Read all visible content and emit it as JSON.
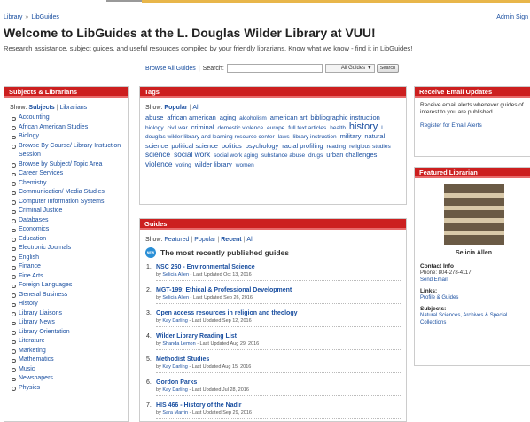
{
  "breadcrumb": {
    "library": "Library",
    "separator": "»",
    "libguides": "LibGuides"
  },
  "admin_label": "Admin Sign",
  "page_title": "Welcome to LibGuides at the L. Douglas Wilder Library at VUU!",
  "subtitle": "Research assistance, subject guides, and useful resources compiled by your friendly librarians. Know what we know - find it in LibGuides!",
  "search": {
    "browse_label": "Browse All Guides",
    "separator": "|",
    "search_label": "Search:",
    "input_value": "",
    "scope_selected": "All Guides ▼",
    "button_label": "Search"
  },
  "subjects": {
    "header": "Subjects & Librarians",
    "show_label": "Show:",
    "subjects_tab": "Subjects",
    "pipe": "|",
    "librarians_tab": "Librarians",
    "items": [
      "Accounting",
      "African American Studies",
      "Biology",
      "Browse By Course/ Library Instuction Session",
      "Browse by Subject/ Topic Area",
      "Career Services",
      "Chemistry",
      "Communication/ Media Studies",
      "Computer Information Systems",
      "Criminal Justice",
      "Databases",
      "Economics",
      "Education",
      "Electronic Journals",
      "English",
      "Finance",
      "Fine Arts",
      "Foreign Languages",
      "General Business",
      "History",
      "Library Liaisons",
      "Library News",
      "Library Orientation",
      "Literature",
      "Marketing",
      "Mathematics",
      "Music",
      "Newspapers",
      "Physics"
    ]
  },
  "tags": {
    "header": "Tags",
    "show_label": "Show:",
    "popular_tab": "Popular",
    "pipe": "|",
    "all_tab": "All",
    "cloud": [
      {
        "text": "abuse",
        "size": 2
      },
      {
        "text": "african american",
        "size": 2
      },
      {
        "text": "aging",
        "size": 2
      },
      {
        "text": "alcoholism",
        "size": 1
      },
      {
        "text": "american art",
        "size": 2
      },
      {
        "text": "bibliographic instruction",
        "size": 2
      },
      {
        "text": "biology",
        "size": 1
      },
      {
        "text": "civil war",
        "size": 1
      },
      {
        "text": "criminal",
        "size": 2
      },
      {
        "text": "domestic violence",
        "size": 1
      },
      {
        "text": "europe",
        "size": 1
      },
      {
        "text": "full text articles",
        "size": 1
      },
      {
        "text": "health",
        "size": 1
      },
      {
        "text": "history",
        "size": 4
      },
      {
        "text": "l. douglas wilder library and learning resource center",
        "size": 1
      },
      {
        "text": "laws",
        "size": 1
      },
      {
        "text": "library instruction",
        "size": 1
      },
      {
        "text": "military",
        "size": 2
      },
      {
        "text": "natural science",
        "size": 2
      },
      {
        "text": "political science",
        "size": 2
      },
      {
        "text": "politics",
        "size": 2
      },
      {
        "text": "psychology",
        "size": 2
      },
      {
        "text": "racial profiling",
        "size": 2
      },
      {
        "text": "reading",
        "size": 1
      },
      {
        "text": "religious studies",
        "size": 1
      },
      {
        "text": "science",
        "size": 3
      },
      {
        "text": "social work",
        "size": 3
      },
      {
        "text": "social work aging",
        "size": 1
      },
      {
        "text": "substance abuse",
        "size": 1
      },
      {
        "text": "drugs",
        "size": 1
      },
      {
        "text": "urban challenges",
        "size": 2
      },
      {
        "text": "violence",
        "size": 3
      },
      {
        "text": "voting",
        "size": 1
      },
      {
        "text": "wilder library",
        "size": 2
      },
      {
        "text": "women",
        "size": 1
      }
    ]
  },
  "guides": {
    "header": "Guides",
    "show_label": "Show:",
    "featured_tab": "Featured",
    "pipe": "|",
    "popular_tab": "Popular",
    "recent_tab": "Recent",
    "all_tab": "All",
    "new_badge": "NEW",
    "recent_heading": "The most recently published guides",
    "by_label": "by",
    "updated_label": "- Last Updated",
    "items": [
      {
        "num": "1.",
        "title": "NSC 260 - Environmental Science",
        "author": "Selicia Allen",
        "date": "Oct 13, 2016"
      },
      {
        "num": "2.",
        "title": "MGT-199: Ethical & Professional Development",
        "author": "Selicia Allen",
        "date": "Sep 26, 2016"
      },
      {
        "num": "3.",
        "title": "Open access resources in religion and theology",
        "author": "Kay Darling",
        "date": "Sep 12, 2016"
      },
      {
        "num": "4.",
        "title": "Wilder Library Reading List",
        "author": "Shanda Lemon",
        "date": "Aug 29, 2016"
      },
      {
        "num": "5.",
        "title": "Methodist Studies",
        "author": "Kay Darling",
        "date": "Aug 15, 2016"
      },
      {
        "num": "6.",
        "title": "Gordon Parks",
        "author": "Kay Darling",
        "date": "Jul 28, 2016"
      },
      {
        "num": "7.",
        "title": "HIS 466 - History of the Nadir",
        "author": "Sara Marrin",
        "date": "Sep 29, 2016"
      }
    ]
  },
  "email_updates": {
    "header": "Receive Email Updates",
    "description": "Receive email alerts whenever guides of interest to you are published.",
    "register_link": "Register for Email Alerts"
  },
  "featured_librarian": {
    "header": "Featured Librarian",
    "name": "Selicia Allen",
    "contact_heading": "Contact Info",
    "phone": "Phone: 804-278-4117",
    "email_link": "Send Email",
    "links_heading": "Links:",
    "profile_link": "Profile & Guides",
    "subjects_heading": "Subjects:",
    "subjects_value": "Natural Sciences, Archives & Special Collections"
  }
}
